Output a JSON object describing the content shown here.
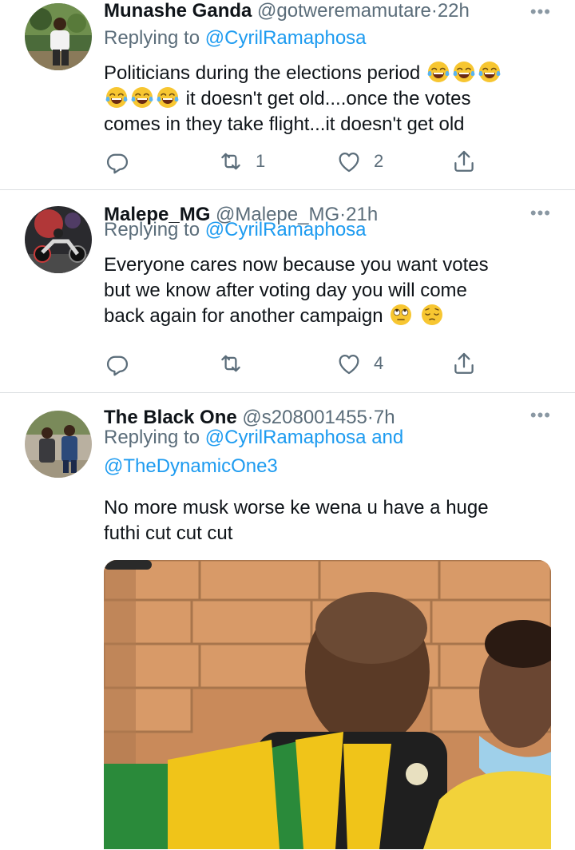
{
  "tweets": [
    {
      "name": "Munashe Ganda",
      "handle": "@gotweremamutare",
      "time": "22h",
      "replying_prefix": "Replying to",
      "replying_to": "@CyrilRamaphosa",
      "text_line1": "Politicians during the elections period",
      "text_line2": "it doesn't get old....once the votes",
      "text_line3": "comes in they take flight...it doesn't get old",
      "retweets": "1",
      "likes": "2",
      "emojis": [
        "tears-of-joy",
        "tears-of-joy",
        "tears-of-joy",
        "tears-of-joy",
        "tears-of-joy",
        "tears-of-joy"
      ]
    },
    {
      "name": "Malepe_MG",
      "handle": "@Malepe_MG",
      "time": "21h",
      "replying_prefix": "Replying to",
      "replying_to": "@CyrilRamaphosa",
      "text_line1": "Everyone cares now because you want votes",
      "text_line2": "but we know after voting day you will come",
      "text_line3": "back again for another campaign",
      "likes": "4",
      "emojis": [
        "eye-roll",
        "pensive"
      ]
    },
    {
      "name": "The Black One",
      "handle": "@s208001455",
      "time": "7h",
      "replying_prefix": "Replying to",
      "replying_to": "@CyrilRamaphosa",
      "replying_and": "and",
      "replying_to2": "@TheDynamicOne3",
      "text_line1": "No more musk worse ke wena u have a huge",
      "text_line2": "futhi cut cut cut"
    }
  ],
  "separator": "·",
  "more_glyph": "•••",
  "colors": {
    "link": "#1d9bf0",
    "secondary": "#5b6d7a",
    "text": "#0f1419",
    "divider": "#dcdfe2"
  },
  "icons": [
    "reply-icon",
    "retweet-icon",
    "like-icon",
    "share-icon",
    "more-icon"
  ]
}
